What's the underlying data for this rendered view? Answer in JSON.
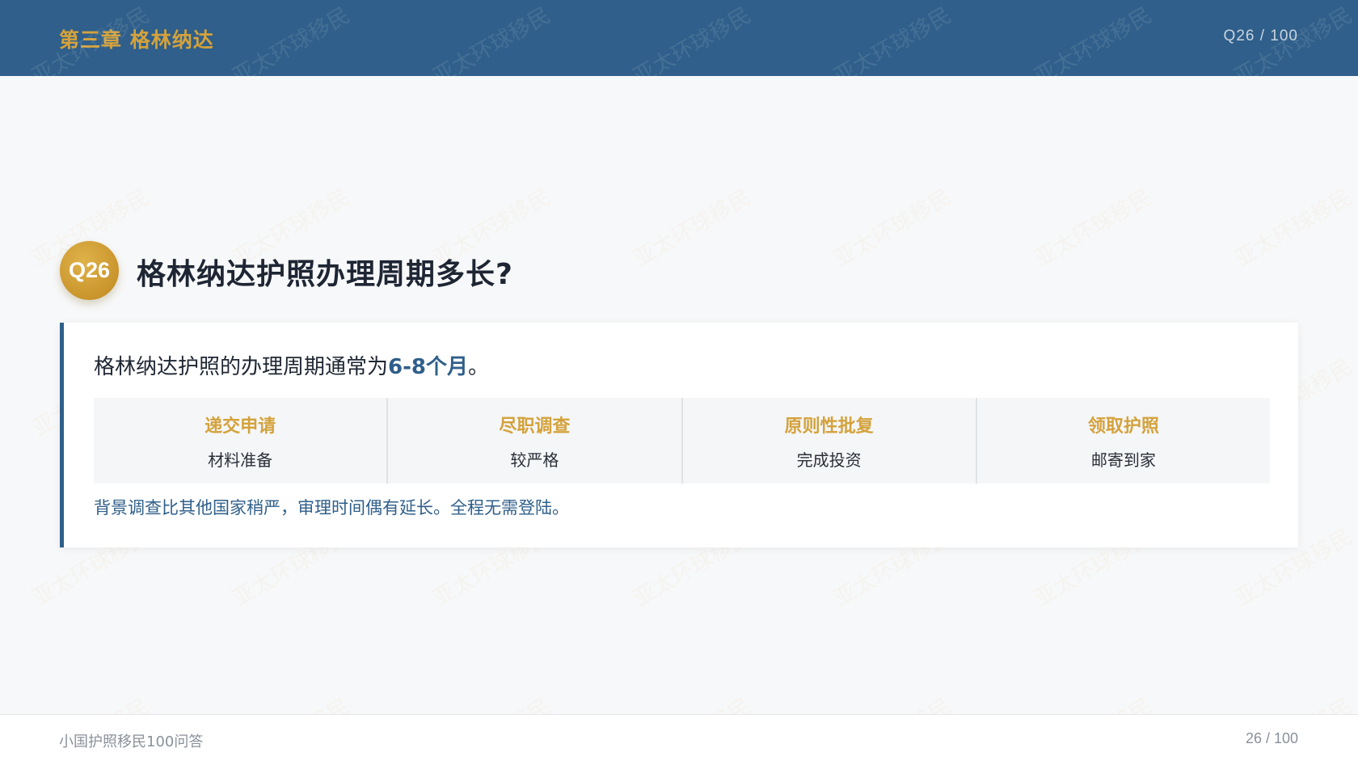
{
  "header": {
    "chapter": "第三章  格林纳达",
    "counter": "Q26 / 100"
  },
  "watermark": {
    "text": "亚太环球移民"
  },
  "question": {
    "badge": "Q26",
    "title": "格林纳达护照办理周期多长?"
  },
  "answer": {
    "lead_text": "格林纳达护照的办理周期通常为",
    "highlight": "6-8个月",
    "trail": "。",
    "steps": [
      {
        "title": "递交申请",
        "desc": "材料准备"
      },
      {
        "title": "尽职调查",
        "desc": "较严格"
      },
      {
        "title": "原则性批复",
        "desc": "完成投资"
      },
      {
        "title": "领取护照",
        "desc": "邮寄到家"
      }
    ],
    "note": "背景调查比其他国家稍严，审理时间偶有延长。全程无需登陆。"
  },
  "footer": {
    "book_title": "小国护照移民100问答",
    "page": "26 / 100"
  },
  "colors": {
    "header_bg": "#2f5f8a",
    "accent_gold": "#d4a23c",
    "accent_blue": "#2f5f8a",
    "page_bg": "#f7f8f9"
  }
}
